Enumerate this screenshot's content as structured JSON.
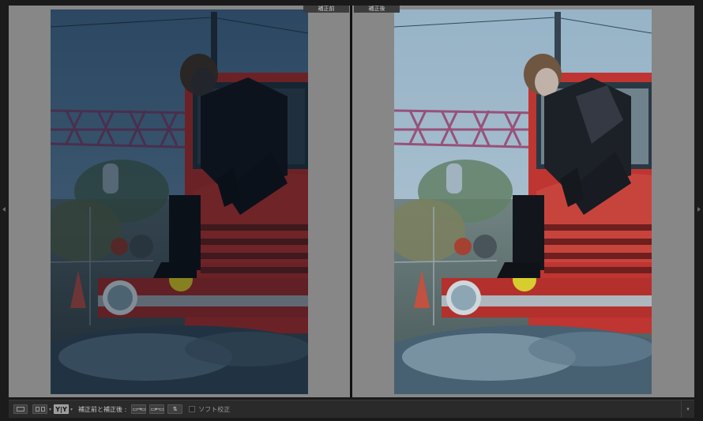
{
  "compare": {
    "before_label": "補正前",
    "after_label": "補正後"
  },
  "toolbar": {
    "view_mode_swap_label": "Y|Y",
    "before_after_label": "補正前と補正後 :",
    "soft_proof_label": "ソフト校正",
    "soft_proof_checked": false
  },
  "colors": {
    "background": "#878787",
    "toolbar": "#2a2a2a",
    "active_button": "#9a9a9a"
  }
}
